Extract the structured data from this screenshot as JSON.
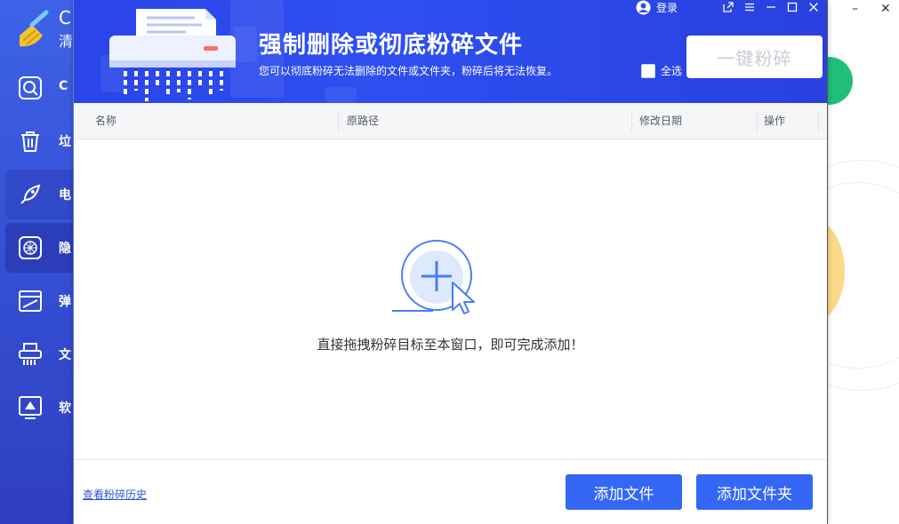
{
  "background_app": {
    "logo_text_line1": "C",
    "logo_text_line2": "清",
    "nav_items": [
      {
        "label": "C",
        "icon": "magnifier-disk-icon"
      },
      {
        "label": "垃",
        "icon": "trash-icon"
      },
      {
        "label": "电",
        "icon": "rocket-icon"
      },
      {
        "label": "隐",
        "icon": "privacy-shield-icon"
      },
      {
        "label": "弹",
        "icon": "popup-block-icon"
      },
      {
        "label": "文",
        "icon": "shredder-icon"
      },
      {
        "label": "软",
        "icon": "software-icon"
      }
    ],
    "window_controls": [
      "–",
      "✕"
    ],
    "colors": {
      "sidebar": "#3651d6",
      "green_badge": "#1fbf7a"
    }
  },
  "dialog": {
    "title": "强制删除或彻底粉碎文件",
    "subtitle": "您可以彻底粉碎无法删除的文件或文件夹，粉碎后将无法恢复。",
    "login_label": "登录",
    "select_all_label": "全选",
    "select_all_checked": false,
    "shred_button_label": "一键粉碎",
    "shred_button_enabled": false,
    "columns": [
      "名称",
      "原路径",
      "修改日期",
      "操作"
    ],
    "rows": [],
    "empty_hint": "直接拖拽粉碎目标至本窗口，即可完成添加！",
    "history_link": "查看粉碎历史",
    "add_file_button": "添加文件",
    "add_folder_button": "添加文件夹",
    "window_controls": [
      "share-icon",
      "menu-icon",
      "maximize-icon",
      "close-icon"
    ],
    "colors": {
      "banner": "#2e4ff0",
      "primary_button": "#3467f5",
      "link": "#2c54d8"
    }
  }
}
